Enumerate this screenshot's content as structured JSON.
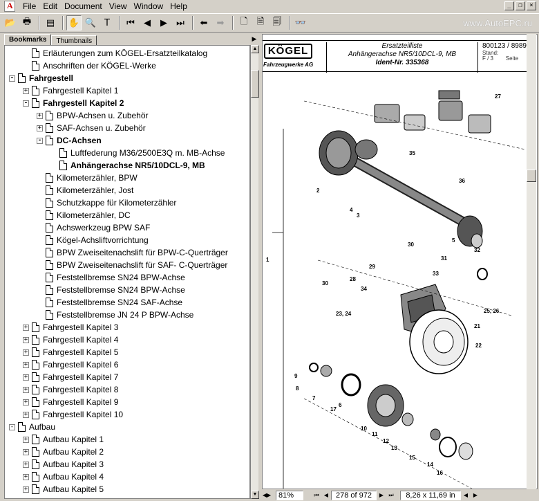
{
  "menu": {
    "items": [
      "File",
      "Edit",
      "Document",
      "View",
      "Window",
      "Help"
    ]
  },
  "watermark": "www.AutoEPC.ru",
  "left_pane": {
    "tabs": [
      "Bookmarks",
      "Thumbnails"
    ],
    "tree": [
      {
        "label": "Erläuterungen zum KÖGEL-Ersatzteilkatalog",
        "level": 1,
        "exp": "",
        "bold": false
      },
      {
        "label": "Anschriften der KÖGEL-Werke",
        "level": 1,
        "exp": "",
        "bold": false
      },
      {
        "label": "Fahrgestell",
        "level": 0,
        "exp": "-",
        "bold": true
      },
      {
        "label": "Fahrgestell Kapitel 1",
        "level": 1,
        "exp": "+",
        "bold": false
      },
      {
        "label": "Fahrgestell Kapitel 2",
        "level": 1,
        "exp": "-",
        "bold": true
      },
      {
        "label": "BPW-Achsen u. Zubehör",
        "level": 2,
        "exp": "+",
        "bold": false
      },
      {
        "label": "SAF-Achsen u. Zubehör",
        "level": 2,
        "exp": "+",
        "bold": false
      },
      {
        "label": "DC-Achsen",
        "level": 2,
        "exp": "-",
        "bold": true
      },
      {
        "label": "Luftfederung M36/2500E3Q m. MB-Achse",
        "level": 3,
        "exp": "",
        "bold": false
      },
      {
        "label": "Anhängerachse NR5/10DCL-9, MB",
        "level": 3,
        "exp": "",
        "bold": true
      },
      {
        "label": "Kilometerzähler, BPW",
        "level": 2,
        "exp": "",
        "bold": false
      },
      {
        "label": "Kilometerzähler, Jost",
        "level": 2,
        "exp": "",
        "bold": false
      },
      {
        "label": "Schutzkappe für Kilometerzähler",
        "level": 2,
        "exp": "",
        "bold": false
      },
      {
        "label": "Kilometerzähler, DC",
        "level": 2,
        "exp": "",
        "bold": false
      },
      {
        "label": "Achswerkzeug BPW SAF",
        "level": 2,
        "exp": "",
        "bold": false
      },
      {
        "label": "Kögel-Achsliftvorrichtung",
        "level": 2,
        "exp": "",
        "bold": false
      },
      {
        "label": "BPW Zweiseitenachslift für BPW-C-Querträger",
        "level": 2,
        "exp": "",
        "bold": false
      },
      {
        "label": "BPW Zweiseitenachslift für SAF- C-Querträger",
        "level": 2,
        "exp": "",
        "bold": false
      },
      {
        "label": "Feststellbremse SN24 BPW-Achse",
        "level": 2,
        "exp": "",
        "bold": false
      },
      {
        "label": "Feststellbremse SN24 BPW-Achse",
        "level": 2,
        "exp": "",
        "bold": false
      },
      {
        "label": "Feststellbremse SN24 SAF-Achse",
        "level": 2,
        "exp": "",
        "bold": false
      },
      {
        "label": "Feststellbremse JN 24 P BPW-Achse",
        "level": 2,
        "exp": "",
        "bold": false
      },
      {
        "label": "Fahrgestell Kapitel 3",
        "level": 1,
        "exp": "+",
        "bold": false
      },
      {
        "label": "Fahrgestell Kapitel 4",
        "level": 1,
        "exp": "+",
        "bold": false
      },
      {
        "label": "Fahrgestell Kapitel 5",
        "level": 1,
        "exp": "+",
        "bold": false
      },
      {
        "label": "Fahrgestell Kapitel 6",
        "level": 1,
        "exp": "+",
        "bold": false
      },
      {
        "label": "Fahrgestell Kapitel 7",
        "level": 1,
        "exp": "+",
        "bold": false
      },
      {
        "label": "Fahrgestell Kapitel 8",
        "level": 1,
        "exp": "+",
        "bold": false
      },
      {
        "label": "Fahrgestell Kapitel 9",
        "level": 1,
        "exp": "+",
        "bold": false
      },
      {
        "label": "Fahrgestell Kapitel 10",
        "level": 1,
        "exp": "+",
        "bold": false
      },
      {
        "label": "Aufbau",
        "level": 0,
        "exp": "-",
        "bold": false
      },
      {
        "label": "Aufbau Kapitel 1",
        "level": 1,
        "exp": "+",
        "bold": false
      },
      {
        "label": "Aufbau Kapitel 2",
        "level": 1,
        "exp": "+",
        "bold": false
      },
      {
        "label": "Aufbau Kapitel 3",
        "level": 1,
        "exp": "+",
        "bold": false
      },
      {
        "label": "Aufbau Kapitel 4",
        "level": 1,
        "exp": "+",
        "bold": false
      },
      {
        "label": "Aufbau Kapitel 5",
        "level": 1,
        "exp": "+",
        "bold": false
      }
    ]
  },
  "document": {
    "logo": "KÖGEL",
    "logo_sub": "Fahrzeugwerke AG",
    "title_line1": "Ersatzteilliste",
    "title_line2": "Anhängerachse NR5/10DCL-9, MB",
    "title_line3": "Ident-Nr. 335368",
    "doc_no": "800123 / 8989",
    "stand_label": "Stand:",
    "page_ref": "F / 3",
    "seite_label": "Seite",
    "callouts": [
      "27",
      "35",
      "2",
      "36",
      "4",
      "3",
      "5",
      "1",
      "30",
      "29",
      "28",
      "31",
      "32",
      "33",
      "30",
      "34",
      "23, 24",
      "25, 26",
      "21",
      "22",
      "9",
      "8",
      "7",
      "6",
      "17",
      "10",
      "11",
      "12",
      "13",
      "15",
      "14",
      "16"
    ]
  },
  "status": {
    "zoom": "81%",
    "page": "278 of 972",
    "size": "8,26 x 11,69 in"
  }
}
